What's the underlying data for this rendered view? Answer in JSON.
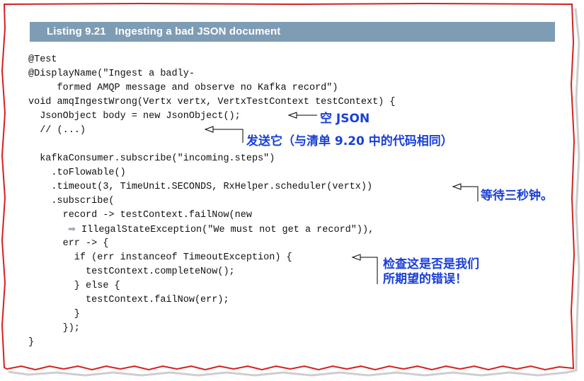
{
  "listing": {
    "label": "Listing 9.21",
    "title": "Ingesting a bad JSON document"
  },
  "code_lines": [
    "@Test",
    "@DisplayName(\"Ingest a badly-",
    "     formed AMQP message and observe no Kafka record\")",
    "void amqIngestWrong(Vertx vertx, VertxTestContext testContext) {",
    "  JsonObject body = new JsonObject();",
    "  // (...)",
    "",
    "  kafkaConsumer.subscribe(\"incoming.steps\")",
    "    .toFlowable()",
    "    .timeout(3, TimeUnit.SECONDS, RxHelper.scheduler(vertx))",
    "    .subscribe(",
    "      record -> testContext.failNow(new",
    "IllegalStateException(\"We must not get a record\")),",
    "      err -> {",
    "        if (err instanceof TimeoutException) {",
    "          testContext.completeNow();",
    "        } else {",
    "          testContext.failNow(err);",
    "        }",
    "      });",
    "}"
  ],
  "annotations": {
    "empty_json": "空 JSON",
    "send_it": "发送它（与清单 9.20 中的代码相同）",
    "wait": "等待三秒钟。",
    "check_line1": "检查这是否是我们",
    "check_line2": "所期望的错误！"
  },
  "colors": {
    "header_bg": "#7f9cb5",
    "annotation": "#1a3fd6",
    "border": "#d42020"
  }
}
